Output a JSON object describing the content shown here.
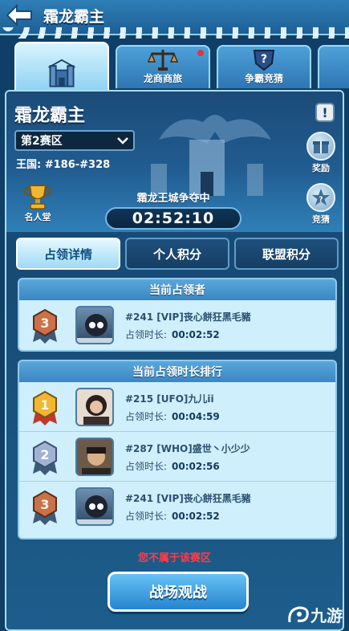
{
  "header": {
    "title": "霜龙霸主"
  },
  "tabs": [
    {
      "label": "",
      "active": true
    },
    {
      "label": "龙商商旅",
      "active": false,
      "notify": true
    },
    {
      "label": "争霸竞猜",
      "active": false
    }
  ],
  "panel": {
    "title": "霜龙霸主",
    "help": "!",
    "zone": "第2赛区",
    "kingdom_label": "王国:",
    "kingdom_range": "#186-#328",
    "hall_label": "名人堂",
    "reward_label": "奖励",
    "guess_label": "竞猜",
    "contest_caption": "霜龙王城争夺中",
    "timer": "02:52:10"
  },
  "subtabs": [
    "占领详情",
    "个人积分",
    "联盟积分"
  ],
  "current_holder": {
    "heading": "当前占领者",
    "rank": 3,
    "name": "#241 [VIP]丧心餅狂黑毛豬",
    "duration_label": "占领时长:",
    "duration": "00:02:52"
  },
  "ranking": {
    "heading": "当前占领时长排行",
    "rows": [
      {
        "rank": 1,
        "name": "#215 [UFO]九儿ii",
        "duration_label": "占领时长:",
        "duration": "00:04:59"
      },
      {
        "rank": 2,
        "name": "#287 [WHO]盛世丶小少少",
        "duration_label": "占领时长:",
        "duration": "00:02:56"
      },
      {
        "rank": 3,
        "name": "#241 [VIP]丧心餅狂黑毛豬",
        "duration_label": "占领时长:",
        "duration": "00:02:52"
      }
    ]
  },
  "footer": {
    "warning": "您不属于该赛区",
    "button": "战场观战",
    "watermark": "九游"
  },
  "colors": {
    "accent": "#3a86c2",
    "warning": "#ff3b4a",
    "gold": "#f2b632",
    "silver": "#9fb3d6",
    "bronze": "#c9714a"
  }
}
